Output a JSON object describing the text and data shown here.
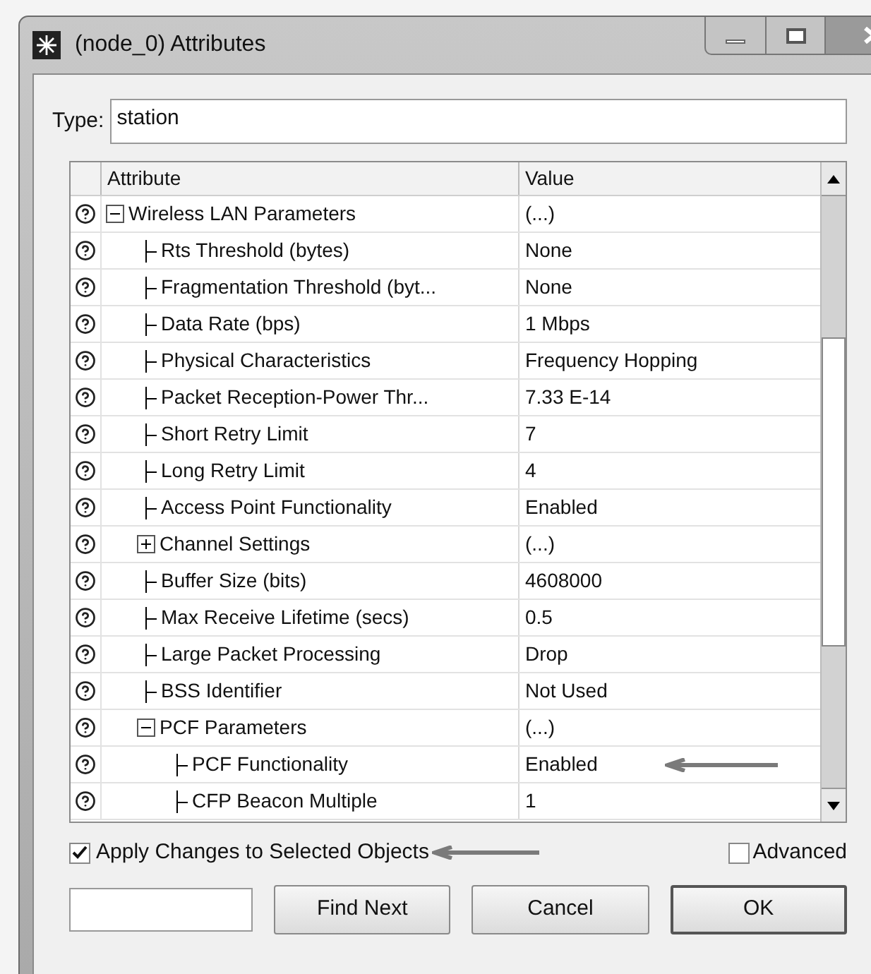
{
  "window": {
    "title": "(node_0) Attributes"
  },
  "type_field": {
    "label": "Type:",
    "value": "station"
  },
  "table": {
    "columns": [
      "Attribute",
      "Value"
    ],
    "rows": [
      {
        "attribute": "Wireless LAN Parameters",
        "value": "(...)",
        "expanded": true,
        "children": [
          {
            "attribute": "Rts Threshold (bytes)",
            "value": "None"
          },
          {
            "attribute": "Fragmentation Threshold (byt...",
            "value": "None"
          },
          {
            "attribute": "Data Rate (bps)",
            "value": "1 Mbps"
          },
          {
            "attribute": "Physical Characteristics",
            "value": "Frequency Hopping"
          },
          {
            "attribute": "Packet Reception-Power Thr...",
            "value": "7.33 E-14"
          },
          {
            "attribute": "Short Retry Limit",
            "value": "7"
          },
          {
            "attribute": "Long Retry Limit",
            "value": "4"
          },
          {
            "attribute": "Access Point Functionality",
            "value": "Enabled"
          },
          {
            "attribute": "Channel Settings",
            "value": "(...)",
            "expanded": false
          },
          {
            "attribute": "Buffer Size (bits)",
            "value": "4608000"
          },
          {
            "attribute": "Max Receive Lifetime (secs)",
            "value": "0.5"
          },
          {
            "attribute": "Large Packet Processing",
            "value": "Drop"
          },
          {
            "attribute": "BSS Identifier",
            "value": "Not Used"
          },
          {
            "attribute": "PCF Parameters",
            "value": "(...)",
            "expanded": true,
            "children": [
              {
                "attribute": "PCF Functionality",
                "value": "Enabled",
                "annotated": true
              },
              {
                "attribute": "CFP Beacon Multiple",
                "value": "1"
              }
            ]
          }
        ]
      }
    ]
  },
  "apply_checkbox": {
    "label": "Apply Changes to Selected Objects",
    "checked": true,
    "annotated": true
  },
  "advanced_checkbox": {
    "label": "Advanced",
    "checked": false
  },
  "buttons": [
    {
      "label": "Find Next",
      "default": false
    },
    {
      "label": "Cancel",
      "default": false
    },
    {
      "label": "OK",
      "default": true
    }
  ]
}
